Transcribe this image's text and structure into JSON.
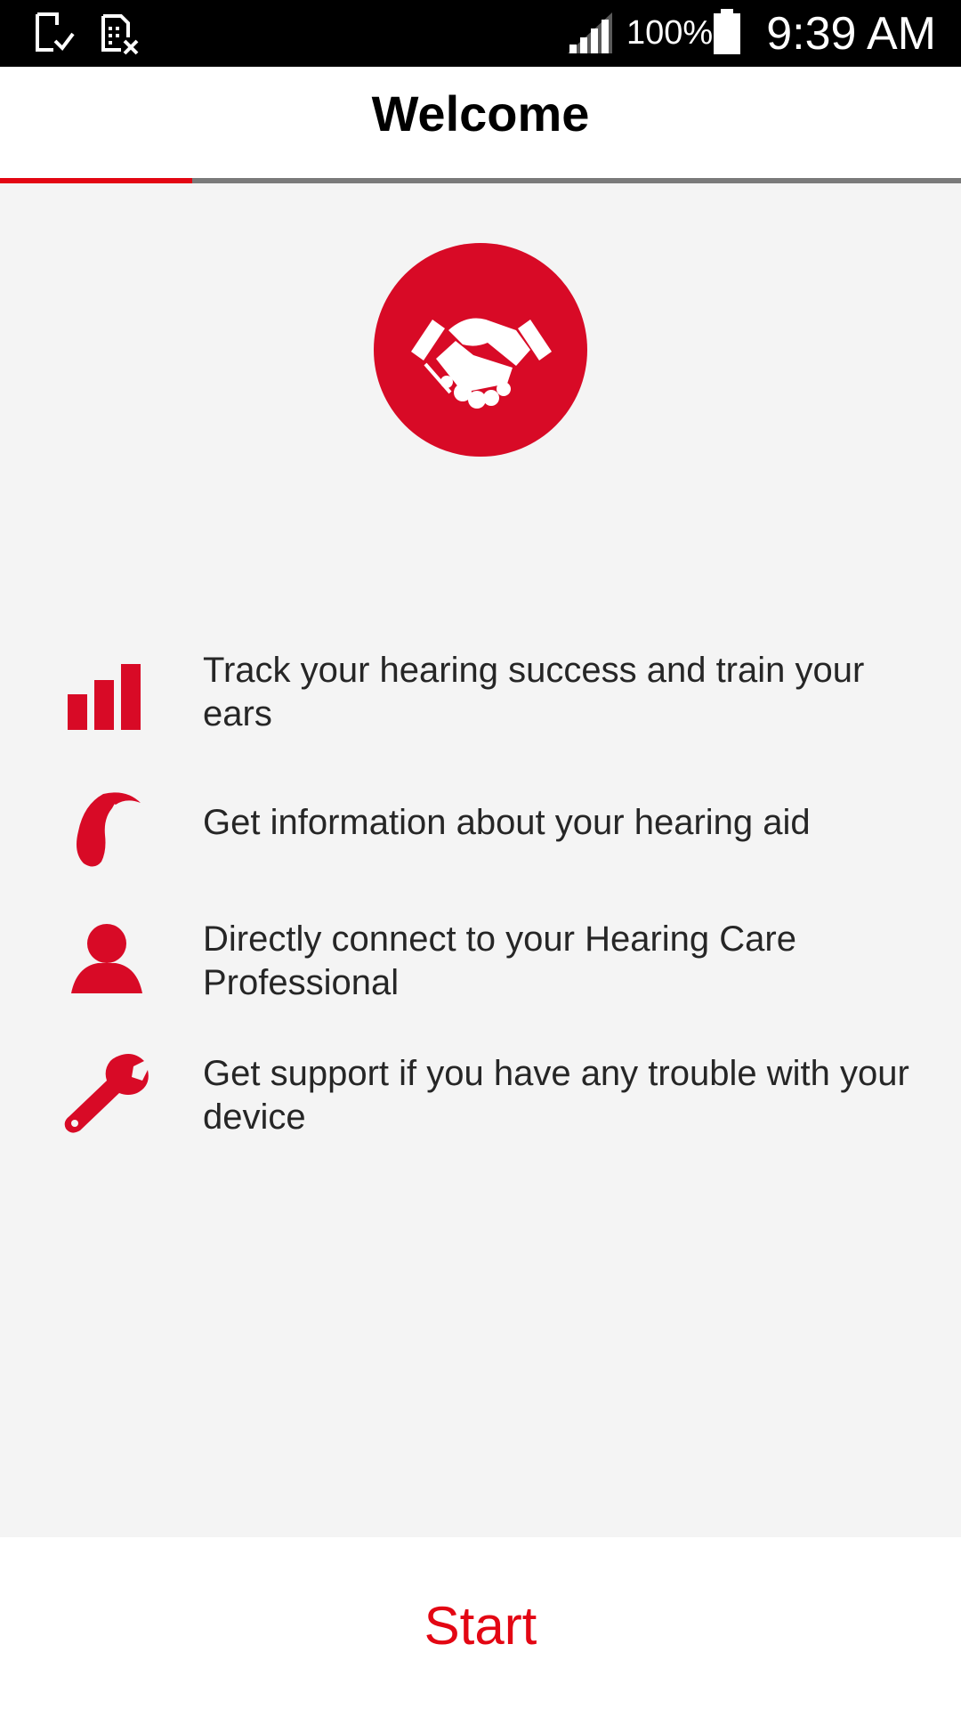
{
  "status_bar": {
    "battery_percent": "100%",
    "time": "9:39 AM",
    "icons": [
      "screenshot-icon",
      "sim-card-x-icon",
      "signal-icon",
      "battery-icon"
    ]
  },
  "header": {
    "title": "Welcome",
    "progress": 0.2
  },
  "hero": {
    "icon": "handshake-icon"
  },
  "features": [
    {
      "icon": "bar-chart-icon",
      "text": "Track your hearing success and train your ears"
    },
    {
      "icon": "hearing-aid-icon",
      "text": "Get information about your hearing aid"
    },
    {
      "icon": "person-icon",
      "text": "Directly connect to your Hearing Care Professional"
    },
    {
      "icon": "wrench-icon",
      "text": "Get support if you have any trouble with your device"
    }
  ],
  "footer": {
    "start_label": "Start"
  },
  "colors": {
    "accent": "#e30613",
    "hero_bg": "#d80a26",
    "background": "#f4f4f4",
    "text": "#262626"
  }
}
